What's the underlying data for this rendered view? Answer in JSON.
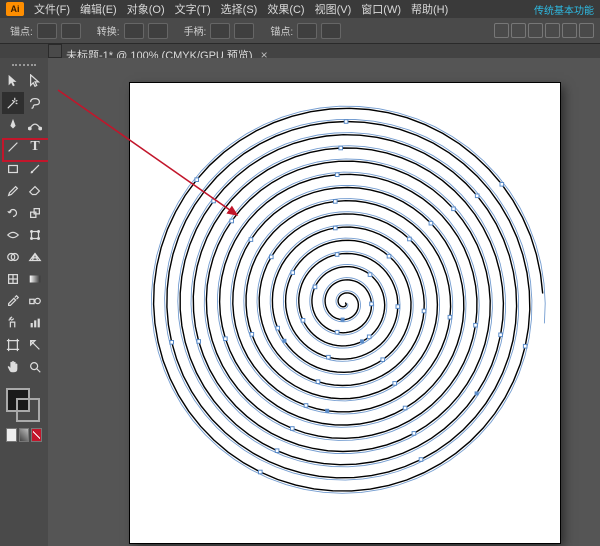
{
  "menu": {
    "items": [
      "文件(F)",
      "编辑(E)",
      "对象(O)",
      "文字(T)",
      "选择(S)",
      "效果(C)",
      "视图(V)",
      "窗口(W)",
      "帮助(H)"
    ],
    "essentials": "传统基本功能"
  },
  "controlbar": {
    "anchors_label": "锚点:",
    "convert_label": "转换:",
    "handles_label": "手柄:",
    "anchor_more_label": "锚点:"
  },
  "tab": {
    "title": "未标题-1* @ 100% (CMYK/GPU 预览)"
  },
  "tool_names": [
    "selection-tool",
    "direct-selection-tool",
    "magic-wand-tool",
    "lasso-tool",
    "pen-tool",
    "curvature-tool",
    "line-segment-tool",
    "type-tool",
    "rectangle-tool",
    "paintbrush-tool",
    "pencil-tool",
    "eraser-tool",
    "rotate-tool",
    "scale-tool",
    "width-tool",
    "free-transform-tool",
    "shape-builder-tool",
    "perspective-grid-tool",
    "mesh-tool",
    "gradient-tool",
    "eyedropper-tool",
    "blend-tool",
    "symbol-sprayer-tool",
    "column-graph-tool",
    "artboard-tool",
    "slice-tool",
    "hand-tool",
    "zoom-tool"
  ],
  "icons": {
    "sel": "▲",
    "dsel": "▷",
    "wand": "✦",
    "lasso": "⌒",
    "pen": "✒",
    "curv": "〰",
    "line": "⟋",
    "type": "T",
    "rect": "▭",
    "brush": "🖌",
    "pencil": "✎",
    "eraser": "◧",
    "rotate": "⟳",
    "scale": "⤢",
    "width": "〰",
    "ftrans": "✥",
    "sbuild": "◑",
    "persp": "☳",
    "mesh": "▦",
    "grad": "◫",
    "eye": "✐",
    "blend": "◎",
    "sym": "✺",
    "graph": "▥",
    "artb": "▭",
    "slice": "✂",
    "hand": "✋",
    "zoom": "🔍"
  },
  "colors": {
    "highlight": "#c2162b",
    "anchor_blue": "#5a8bc8",
    "stroke_black": "#000000"
  }
}
